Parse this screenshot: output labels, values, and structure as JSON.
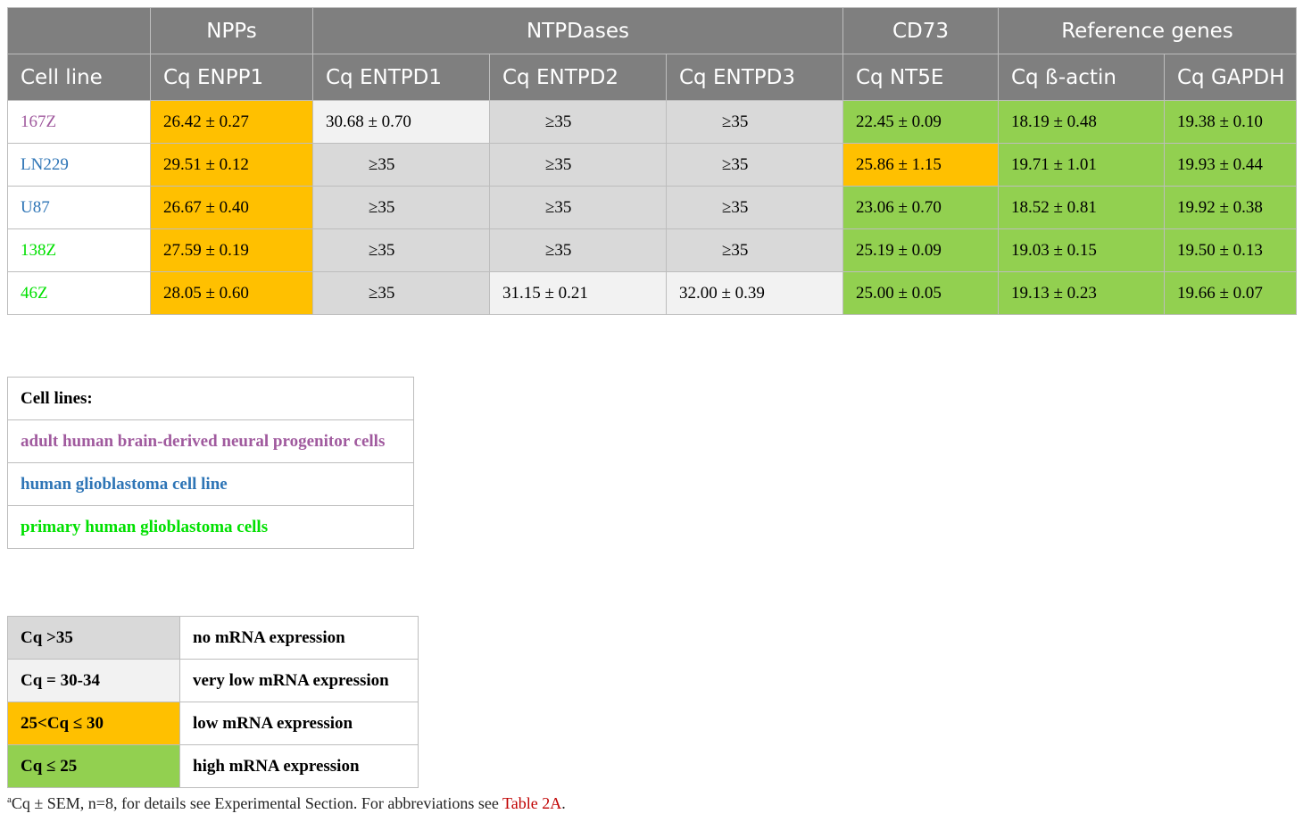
{
  "main_table": {
    "group_headers": [
      {
        "label": ""
      },
      {
        "label": "NPPs"
      },
      {
        "label": "NTPDases"
      },
      {
        "label": "CD73"
      },
      {
        "label": "Reference genes"
      }
    ],
    "column_headers": [
      "Cell line",
      "Cq ENPP1",
      "Cq ENTPD1",
      "Cq ENTPD2",
      "Cq ENTPD3",
      "Cq NT5E",
      "Cq ß-actin",
      "Cq GAPDH"
    ],
    "rows": [
      {
        "cell_line": "167Z",
        "name_color": "#a05a9e",
        "values": [
          "26.42 ± 0.27",
          "30.68 ± 0.70",
          "≥35",
          "≥35",
          "22.45 ± 0.09",
          "18.19 ± 0.48",
          "19.38 ± 0.10"
        ],
        "levels": [
          "low",
          "very-low",
          "none",
          "none",
          "high",
          "high",
          "high"
        ]
      },
      {
        "cell_line": "LN229",
        "name_color": "#2e75b6",
        "values": [
          "29.51 ± 0.12",
          "≥35",
          "≥35",
          "≥35",
          "25.86 ± 1.15",
          "19.71 ± 1.01",
          "19.93 ± 0.44"
        ],
        "levels": [
          "low",
          "none",
          "none",
          "none",
          "low",
          "high",
          "high"
        ]
      },
      {
        "cell_line": "U87",
        "name_color": "#2e75b6",
        "values": [
          "26.67 ± 0.40",
          "≥35",
          "≥35",
          "≥35",
          "23.06 ± 0.70",
          "18.52 ± 0.81",
          "19.92 ± 0.38"
        ],
        "levels": [
          "low",
          "none",
          "none",
          "none",
          "high",
          "high",
          "high"
        ]
      },
      {
        "cell_line": "138Z",
        "name_color": "#00e000",
        "values": [
          "27.59 ± 0.19",
          "≥35",
          "≥35",
          "≥35",
          "25.19 ± 0.09",
          "19.03 ± 0.15",
          "19.50 ± 0.13"
        ],
        "levels": [
          "low",
          "none",
          "none",
          "none",
          "high",
          "high",
          "high"
        ]
      },
      {
        "cell_line": "46Z",
        "name_color": "#00e000",
        "values": [
          "28.05 ± 0.60",
          "≥35",
          "31.15 ± 0.21",
          "32.00 ± 0.39",
          "25.00 ± 0.05",
          "19.13 ± 0.23",
          "19.66 ± 0.07"
        ],
        "levels": [
          "low",
          "none",
          "very-low",
          "very-low",
          "high",
          "high",
          "high"
        ]
      }
    ]
  },
  "cell_legend": {
    "title": "Cell lines:",
    "items": [
      {
        "label": "adult human brain-derived neural progenitor cells",
        "color": "#a05a9e"
      },
      {
        "label": "human glioblastoma cell line",
        "color": "#2e75b6"
      },
      {
        "label": "primary human glioblastoma cells",
        "color": "#00e000"
      }
    ]
  },
  "cq_legend": [
    {
      "range": "Cq >35",
      "description": "no mRNA expression",
      "color": "#d9d9d9"
    },
    {
      "range": "Cq = 30-34",
      "description": "very low mRNA expression",
      "color": "#f2f2f2"
    },
    {
      "range": "25<Cq ≤ 30",
      "description": "low mRNA expression",
      "color": "#ffc000"
    },
    {
      "range": "Cq ≤ 25",
      "description": "high mRNA expression",
      "color": "#92d050"
    }
  ],
  "footnote": {
    "marker": "a",
    "text": "Cq ± SEM, n=8, for details see Experimental Section. For abbreviations see ",
    "link": "Table 2A",
    "end": "."
  }
}
